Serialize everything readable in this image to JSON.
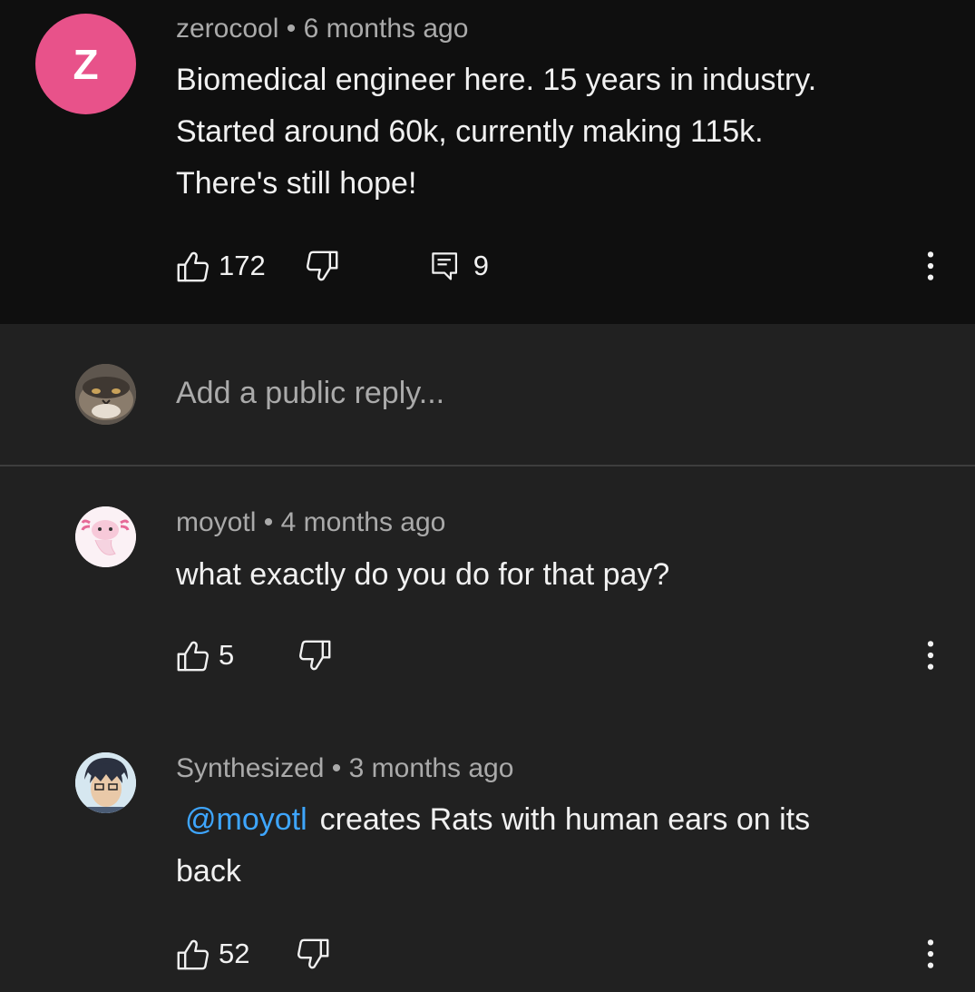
{
  "thread": {
    "comment": {
      "avatar_letter": "Z",
      "avatar_color": "#e8528a",
      "author": "zerocool",
      "separator": "•",
      "time": "6 months ago",
      "lines": [
        "Biomedical engineer here.  15 years in industry.",
        "Started around 60k, currently making  115k.",
        "There's still hope!"
      ],
      "likes": "172",
      "replies": "9"
    },
    "reply_box": {
      "placeholder": "Add a public reply..."
    },
    "replies": [
      {
        "author": "moyotl",
        "time": "4 months ago",
        "text": "what exactly do you do for that pay?",
        "likes": "5"
      },
      {
        "author": "Synthesized",
        "time": "3 months ago",
        "mention": "@moyotl",
        "text_line1": "creates Rats with human ears on its",
        "text_line2": "back",
        "likes": "52"
      }
    ]
  },
  "colors": {
    "background_top": "#0f0f0f",
    "background": "#212121",
    "text": "#f1f1f1",
    "secondary_text": "#aaaaaa",
    "link": "#3ea6ff"
  },
  "icons": [
    "thumbs-up-icon",
    "thumbs-down-icon",
    "reply-icon",
    "more-vert-icon"
  ]
}
